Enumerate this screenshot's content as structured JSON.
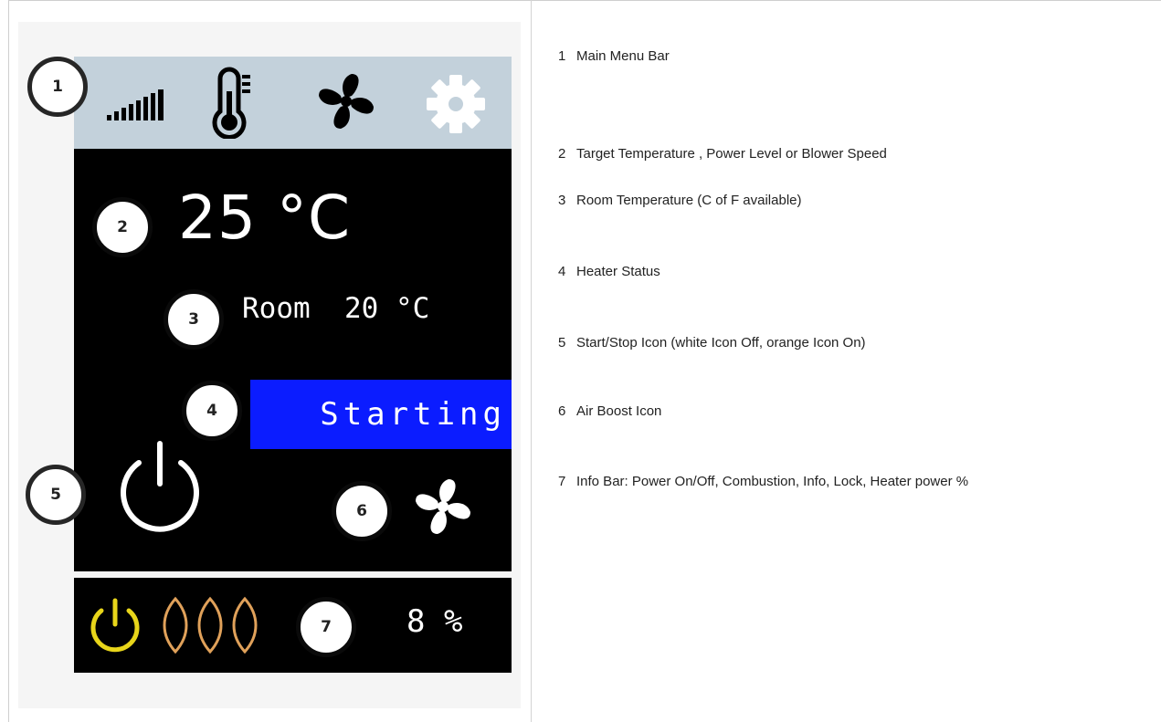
{
  "display": {
    "menu_bar": {
      "items": [
        {
          "icon": "power-level-icon"
        },
        {
          "icon": "thermometer-icon"
        },
        {
          "icon": "fan-icon"
        },
        {
          "icon": "gear-icon"
        }
      ],
      "background_color": "#c3d1db"
    },
    "target_temperature": "25 °C",
    "room_temperature": "Room  20 °C",
    "status": "Starting",
    "status_color": "#0b1cff",
    "start_stop_icon": "power-icon",
    "air_boost_icon": "fan-icon",
    "info_bar": {
      "power_icon_color": "#e8d51a",
      "combustion_icon_color": "#e0a15a",
      "heater_power": "8 %"
    }
  },
  "callouts": [
    "1",
    "2",
    "3",
    "4",
    "5",
    "6",
    "7"
  ],
  "legend": [
    {
      "num": "1",
      "text": "Main Menu Bar"
    },
    {
      "num": "2",
      "text": "Target Temperature , Power Level or Blower Speed"
    },
    {
      "num": "3",
      "text": "Room Temperature (C of F available)"
    },
    {
      "num": "4",
      "text": "Heater Status"
    },
    {
      "num": "5",
      "text": "Start/Stop Icon  (white Icon Off, orange Icon On)"
    },
    {
      "num": "6",
      "text": "Air Boost Icon"
    },
    {
      "num": "7",
      "text": "Info Bar: Power On/Off, Combustion, Info, Lock, Heater power %"
    }
  ]
}
